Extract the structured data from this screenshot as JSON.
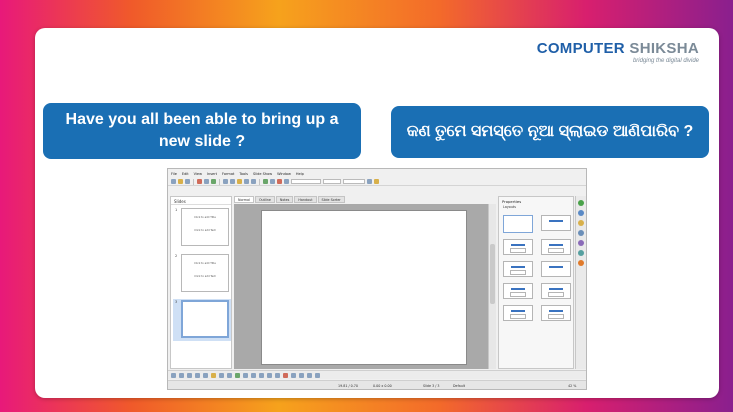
{
  "logo": {
    "word1": "COMPUTER",
    "word2": "SHIKSHA",
    "tagline": "bridging the digital divide"
  },
  "question_en": "Have you all been able to bring up a new slide ?",
  "question_or": "କଣ ତୁମେ ସମସ୍ତେ ନୂଆ ସ୍ଲାଇଡ ଆଣିପାରିବ ?",
  "app": {
    "menu": [
      "File",
      "Edit",
      "View",
      "Insert",
      "Format",
      "Tools",
      "Slide Show",
      "Window",
      "Help"
    ],
    "slides_pane_title": "Slides",
    "view_tabs": [
      "Normal",
      "Outline",
      "Notes",
      "Handout",
      "Slide Sorter"
    ],
    "thumbnails": [
      {
        "number": "1",
        "title": "Click to add Title",
        "text": "Click to add Text"
      },
      {
        "number": "2",
        "title": "Click to add Title",
        "text": "Click to add Text"
      },
      {
        "number": "3",
        "title": "",
        "text": ""
      }
    ],
    "properties_title": "Properties",
    "layouts_label": "Layouts",
    "status": {
      "position": "19.81 / 0.70",
      "size": "0.00 x 0.00",
      "slide": "Slide 3 / 3",
      "master": "Default",
      "zoom": "42 %"
    }
  },
  "colors": {
    "bubble": "#1a6fb4",
    "logo_blue": "#1f5fa8",
    "logo_gray": "#7b8a97"
  }
}
